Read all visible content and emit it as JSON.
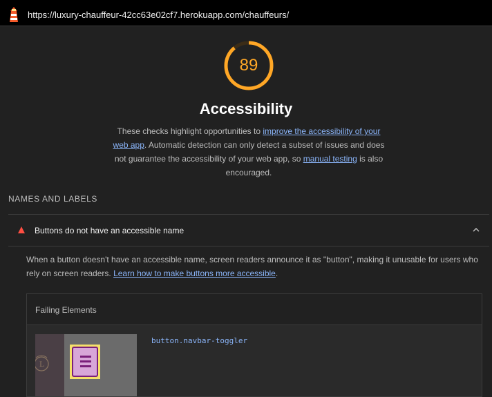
{
  "browser": {
    "url": "https://luxury-chauffeur-42cc63e02cf7.herokuapp.com/chauffeurs/",
    "logo_icon": "lighthouse-icon"
  },
  "category": {
    "score": "89",
    "score_fraction": 0.89,
    "score_color": "#ffa726",
    "title": "Accessibility",
    "description": {
      "text_1": "These checks highlight opportunities to ",
      "link_1": "improve the accessibility of your web app",
      "text_2": ". Automatic detection can only detect a subset of issues and does not guarantee the accessibility of your web app, so ",
      "link_2": "manual testing",
      "text_3": " is also encouraged."
    }
  },
  "group": {
    "title": "NAMES AND LABELS"
  },
  "audit": {
    "status_icon": "fail-triangle-icon",
    "status_color": "#ff4e42",
    "title": "Buttons do not have an accessible name",
    "chevron_icon": "chevron-up-icon",
    "description": {
      "text_1": "When a button doesn't have an accessible name, screen readers announce it as \"button\", making it unusable for users who rely on screen readers. ",
      "link": "Learn how to make buttons more accessible",
      "text_2": "."
    },
    "table": {
      "header": "Failing Elements",
      "rows": [
        {
          "selector": "button.navbar-toggler",
          "thumbnail_icon": "navbar-toggler-thumbnail"
        }
      ]
    }
  }
}
